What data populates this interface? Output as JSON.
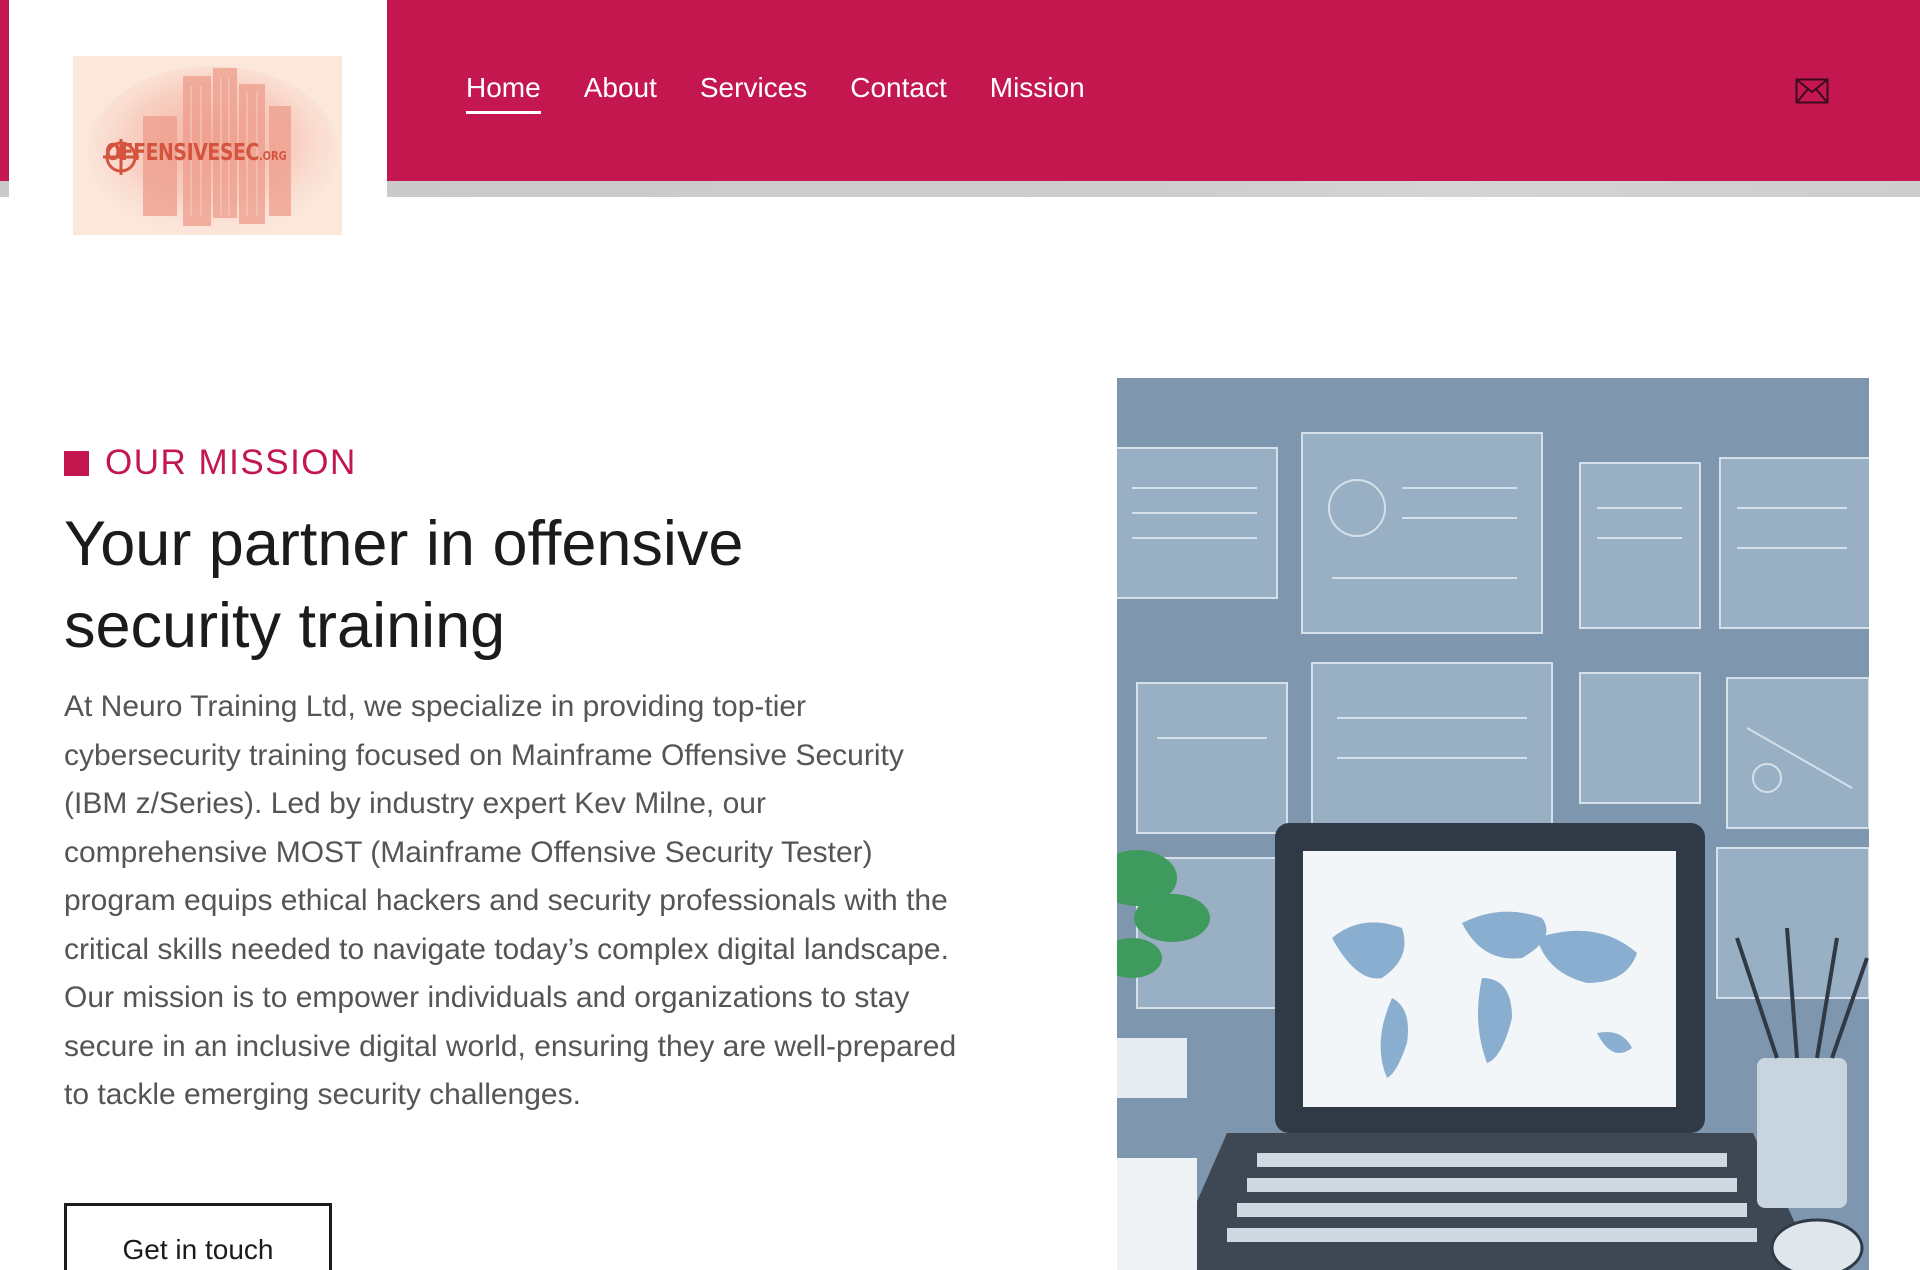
{
  "header": {
    "logo": {
      "text": "OFFENSIVESEC",
      "suffix": ".ORG"
    },
    "nav": [
      {
        "label": "Home",
        "active": true
      },
      {
        "label": "About",
        "active": false
      },
      {
        "label": "Services",
        "active": false
      },
      {
        "label": "Contact",
        "active": false
      },
      {
        "label": "Mission",
        "active": false
      }
    ],
    "mail_icon": "envelope-icon"
  },
  "hero": {
    "eyebrow": "OUR MISSION",
    "title": "Your partner in offensive security training",
    "body": "At Neuro Training Ltd, we specialize in providing top-tier cybersecurity training focused on Mainframe Offensive Security (IBM z/Series). Led by industry expert Kev Milne, our comprehensive MOST (Mainframe Offensive Security Tester) program equips ethical hackers and security professionals with the critical skills needed to navigate today’s complex digital landscape. Our mission is to empower individuals and organizations to stay secure in an inclusive digital world, ensuring they are well-prepared to tackle emerging security challenges.",
    "cta_label": "Get in touch"
  },
  "colors": {
    "brand": "#c4164f",
    "logo_bg": "#fbe7dc",
    "logo_text": "#d4543f"
  }
}
